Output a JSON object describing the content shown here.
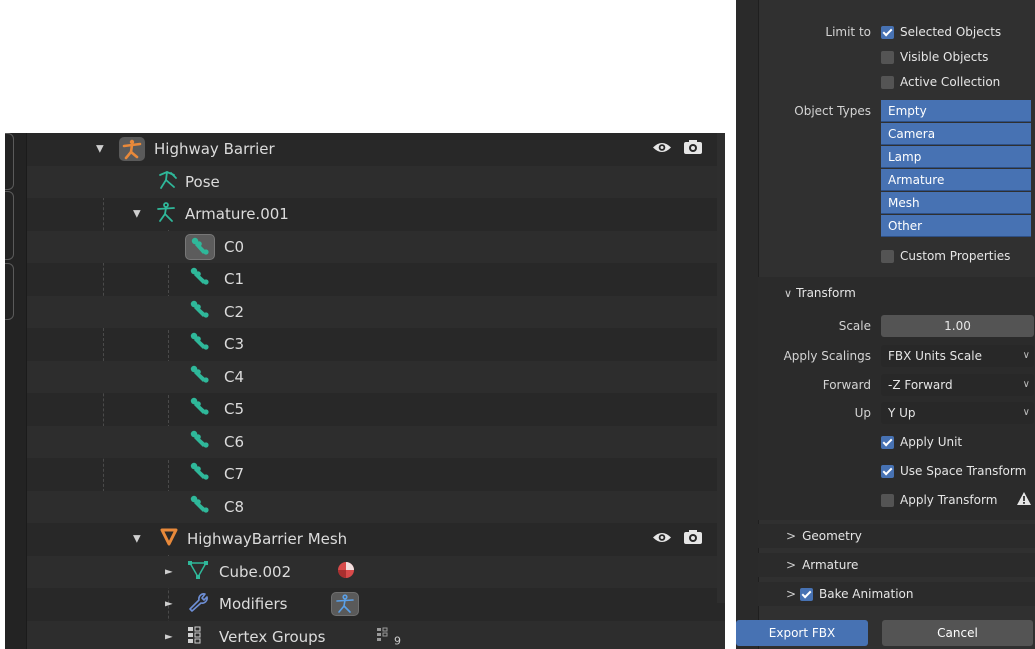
{
  "outliner": {
    "highway_barrier": "Highway Barrier",
    "pose": "Pose",
    "armature": "Armature.001",
    "bones": [
      "C0",
      "C1",
      "C2",
      "C3",
      "C4",
      "C5",
      "C6",
      "C7",
      "C8"
    ],
    "mesh_object": "HighwayBarrier Mesh",
    "cube": "Cube.002",
    "modifiers": "Modifiers",
    "vertex_groups": "Vertex Groups",
    "vertex_group_count": "9"
  },
  "export_panel": {
    "limit_to_label": "Limit to",
    "limit_options": [
      {
        "label": "Selected Objects",
        "checked": true
      },
      {
        "label": "Visible Objects",
        "checked": false
      },
      {
        "label": "Active Collection",
        "checked": false
      }
    ],
    "object_types_label": "Object Types",
    "object_types": [
      "Empty",
      "Camera",
      "Lamp",
      "Armature",
      "Mesh",
      "Other"
    ],
    "custom_properties": {
      "label": "Custom Properties",
      "checked": false
    },
    "transform": {
      "header": "Transform",
      "scale_label": "Scale",
      "scale_value": "1.00",
      "apply_scalings_label": "Apply Scalings",
      "apply_scalings_value": "FBX Units Scale",
      "forward_label": "Forward",
      "forward_value": "-Z Forward",
      "up_label": "Up",
      "up_value": "Y Up",
      "apply_unit": {
        "label": "Apply Unit",
        "checked": true
      },
      "use_space_transform": {
        "label": "Use Space Transform",
        "checked": true
      },
      "apply_transform": {
        "label": "Apply Transform",
        "checked": false
      }
    },
    "geometry_header": "Geometry",
    "armature_header": "Armature",
    "bake_animation": {
      "label": "Bake Animation",
      "checked": true
    },
    "export_button": "Export FBX",
    "cancel_button": "Cancel"
  },
  "colors": {
    "accent": "#4772b3",
    "bone_green": "#2fb89a",
    "object_orange": "#e8893a"
  }
}
